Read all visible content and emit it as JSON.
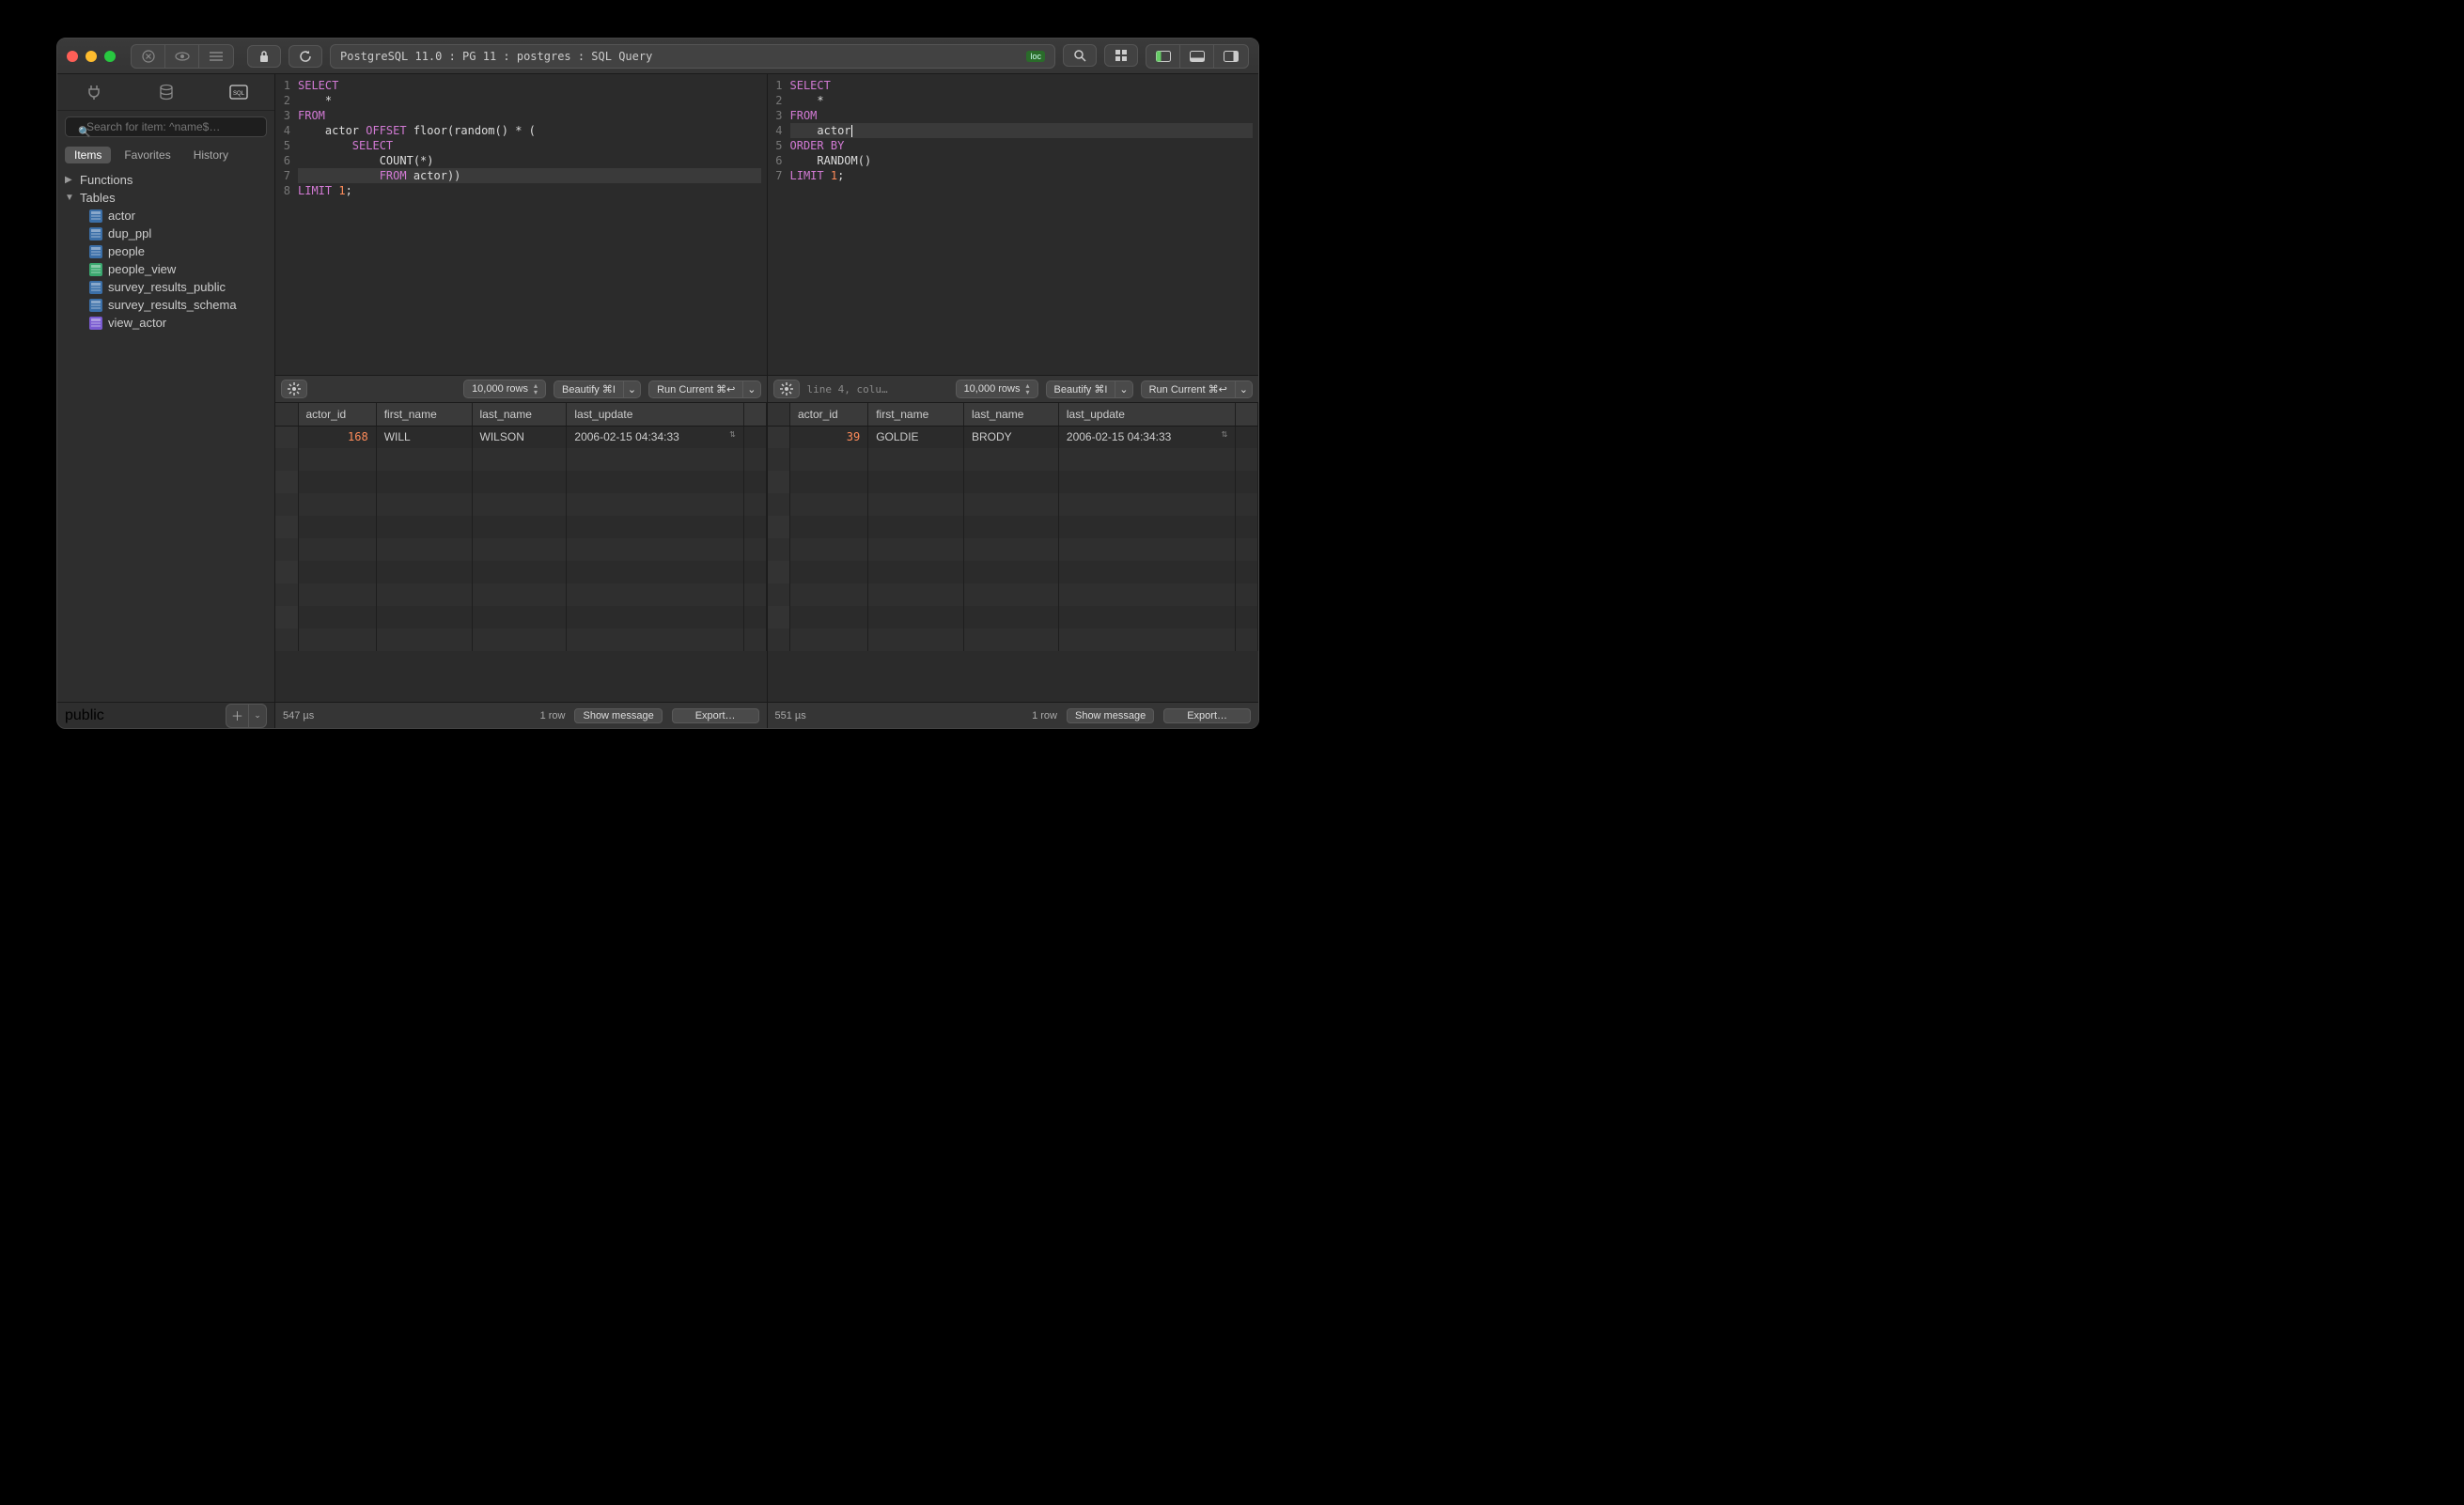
{
  "titlebar": {
    "breadcrumb": "PostgreSQL 11.0 : PG 11 : postgres : SQL Query",
    "loc_badge": "loc"
  },
  "sidebar": {
    "search_placeholder": "Search for item: ^name$…",
    "tabs": [
      "Items",
      "Favorites",
      "History"
    ],
    "active_tab": 0,
    "functions_label": "Functions",
    "tables_label": "Tables",
    "tables": [
      {
        "name": "actor",
        "kind": "table"
      },
      {
        "name": "dup_ppl",
        "kind": "table"
      },
      {
        "name": "people",
        "kind": "table"
      },
      {
        "name": "people_view",
        "kind": "view"
      },
      {
        "name": "survey_results_public",
        "kind": "table"
      },
      {
        "name": "survey_results_schema",
        "kind": "table"
      },
      {
        "name": "view_actor",
        "kind": "view2"
      }
    ],
    "schema": "public"
  },
  "pane_left": {
    "code_lines": [
      [
        {
          "t": "SELECT",
          "c": "kw"
        }
      ],
      [
        {
          "t": "    *",
          "c": ""
        }
      ],
      [
        {
          "t": "FROM",
          "c": "kw"
        }
      ],
      [
        {
          "t": "    actor ",
          "c": ""
        },
        {
          "t": "OFFSET",
          "c": "kw"
        },
        {
          "t": " floor(random() * (",
          "c": ""
        }
      ],
      [
        {
          "t": "        ",
          "c": ""
        },
        {
          "t": "SELECT",
          "c": "kw"
        }
      ],
      [
        {
          "t": "            COUNT(*)",
          "c": ""
        }
      ],
      [
        {
          "t": "            ",
          "c": ""
        },
        {
          "t": "FROM",
          "c": "kw"
        },
        {
          "t": " actor))",
          "c": ""
        }
      ],
      [
        {
          "t": "LIMIT",
          "c": "kw"
        },
        {
          "t": " ",
          "c": ""
        },
        {
          "t": "1",
          "c": "num"
        },
        {
          "t": ";",
          "c": ""
        }
      ]
    ],
    "current_line": 7,
    "rows_selector": "10,000 rows",
    "beautify": "Beautify ⌘I",
    "run": "Run Current ⌘↩",
    "columns": [
      "actor_id",
      "first_name",
      "last_name",
      "last_update"
    ],
    "data": [
      {
        "actor_id": "168",
        "first_name": "WILL",
        "last_name": "WILSON",
        "last_update": "2006-02-15 04:34:33"
      }
    ],
    "elapsed": "547 µs",
    "row_count": "1 row",
    "show_message": "Show message",
    "export": "Export…"
  },
  "pane_right": {
    "code_lines": [
      [
        {
          "t": "SELECT",
          "c": "kw"
        }
      ],
      [
        {
          "t": "    *",
          "c": ""
        }
      ],
      [
        {
          "t": "FROM",
          "c": "kw"
        }
      ],
      [
        {
          "t": "    actor",
          "c": ""
        }
      ],
      [
        {
          "t": "ORDER BY",
          "c": "kw"
        }
      ],
      [
        {
          "t": "    RANDOM()",
          "c": ""
        }
      ],
      [
        {
          "t": "LIMIT",
          "c": "kw"
        },
        {
          "t": " ",
          "c": ""
        },
        {
          "t": "1",
          "c": "num"
        },
        {
          "t": ";",
          "c": ""
        }
      ]
    ],
    "current_line": 4,
    "cursor_col_after": "actor",
    "status": "line 4, colum…",
    "rows_selector": "10,000 rows",
    "beautify": "Beautify ⌘I",
    "run": "Run Current ⌘↩",
    "columns": [
      "actor_id",
      "first_name",
      "last_name",
      "last_update"
    ],
    "data": [
      {
        "actor_id": "39",
        "first_name": "GOLDIE",
        "last_name": "BRODY",
        "last_update": "2006-02-15 04:34:33"
      }
    ],
    "elapsed": "551 µs",
    "row_count": "1 row",
    "show_message": "Show message",
    "export": "Export…"
  }
}
